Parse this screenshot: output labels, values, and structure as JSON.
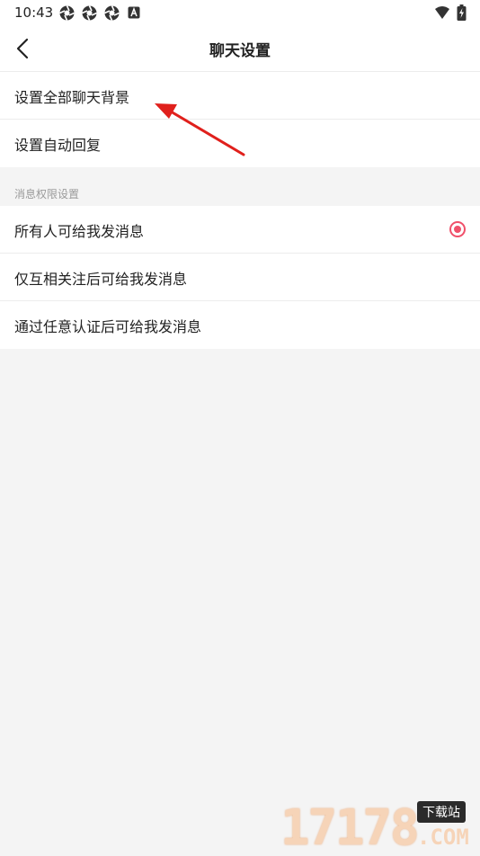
{
  "status_bar": {
    "time": "10:43",
    "notification_icons": [
      "aperture-icon",
      "aperture-icon",
      "aperture-icon",
      "a-badge-icon"
    ],
    "right_icons": [
      "wifi-icon",
      "battery-charging-icon"
    ]
  },
  "header": {
    "title": "聊天设置",
    "back_icon": "chevron-left-icon"
  },
  "settings": {
    "items": [
      {
        "label": "设置全部聊天背景"
      },
      {
        "label": "设置自动回复"
      }
    ]
  },
  "permissions": {
    "section_label": "消息权限设置",
    "options": [
      {
        "label": "所有人可给我发消息",
        "selected": true
      },
      {
        "label": "仅互相关注后可给我发消息",
        "selected": false
      },
      {
        "label": "通过任意认证后可给我发消息",
        "selected": false
      }
    ]
  },
  "colors": {
    "accent": "#f0506a",
    "annotation_arrow": "#e0201c",
    "background": "#f4f4f4"
  },
  "watermark": {
    "digits": "17178",
    "badge": "下载站",
    "suffix": ".COM"
  }
}
